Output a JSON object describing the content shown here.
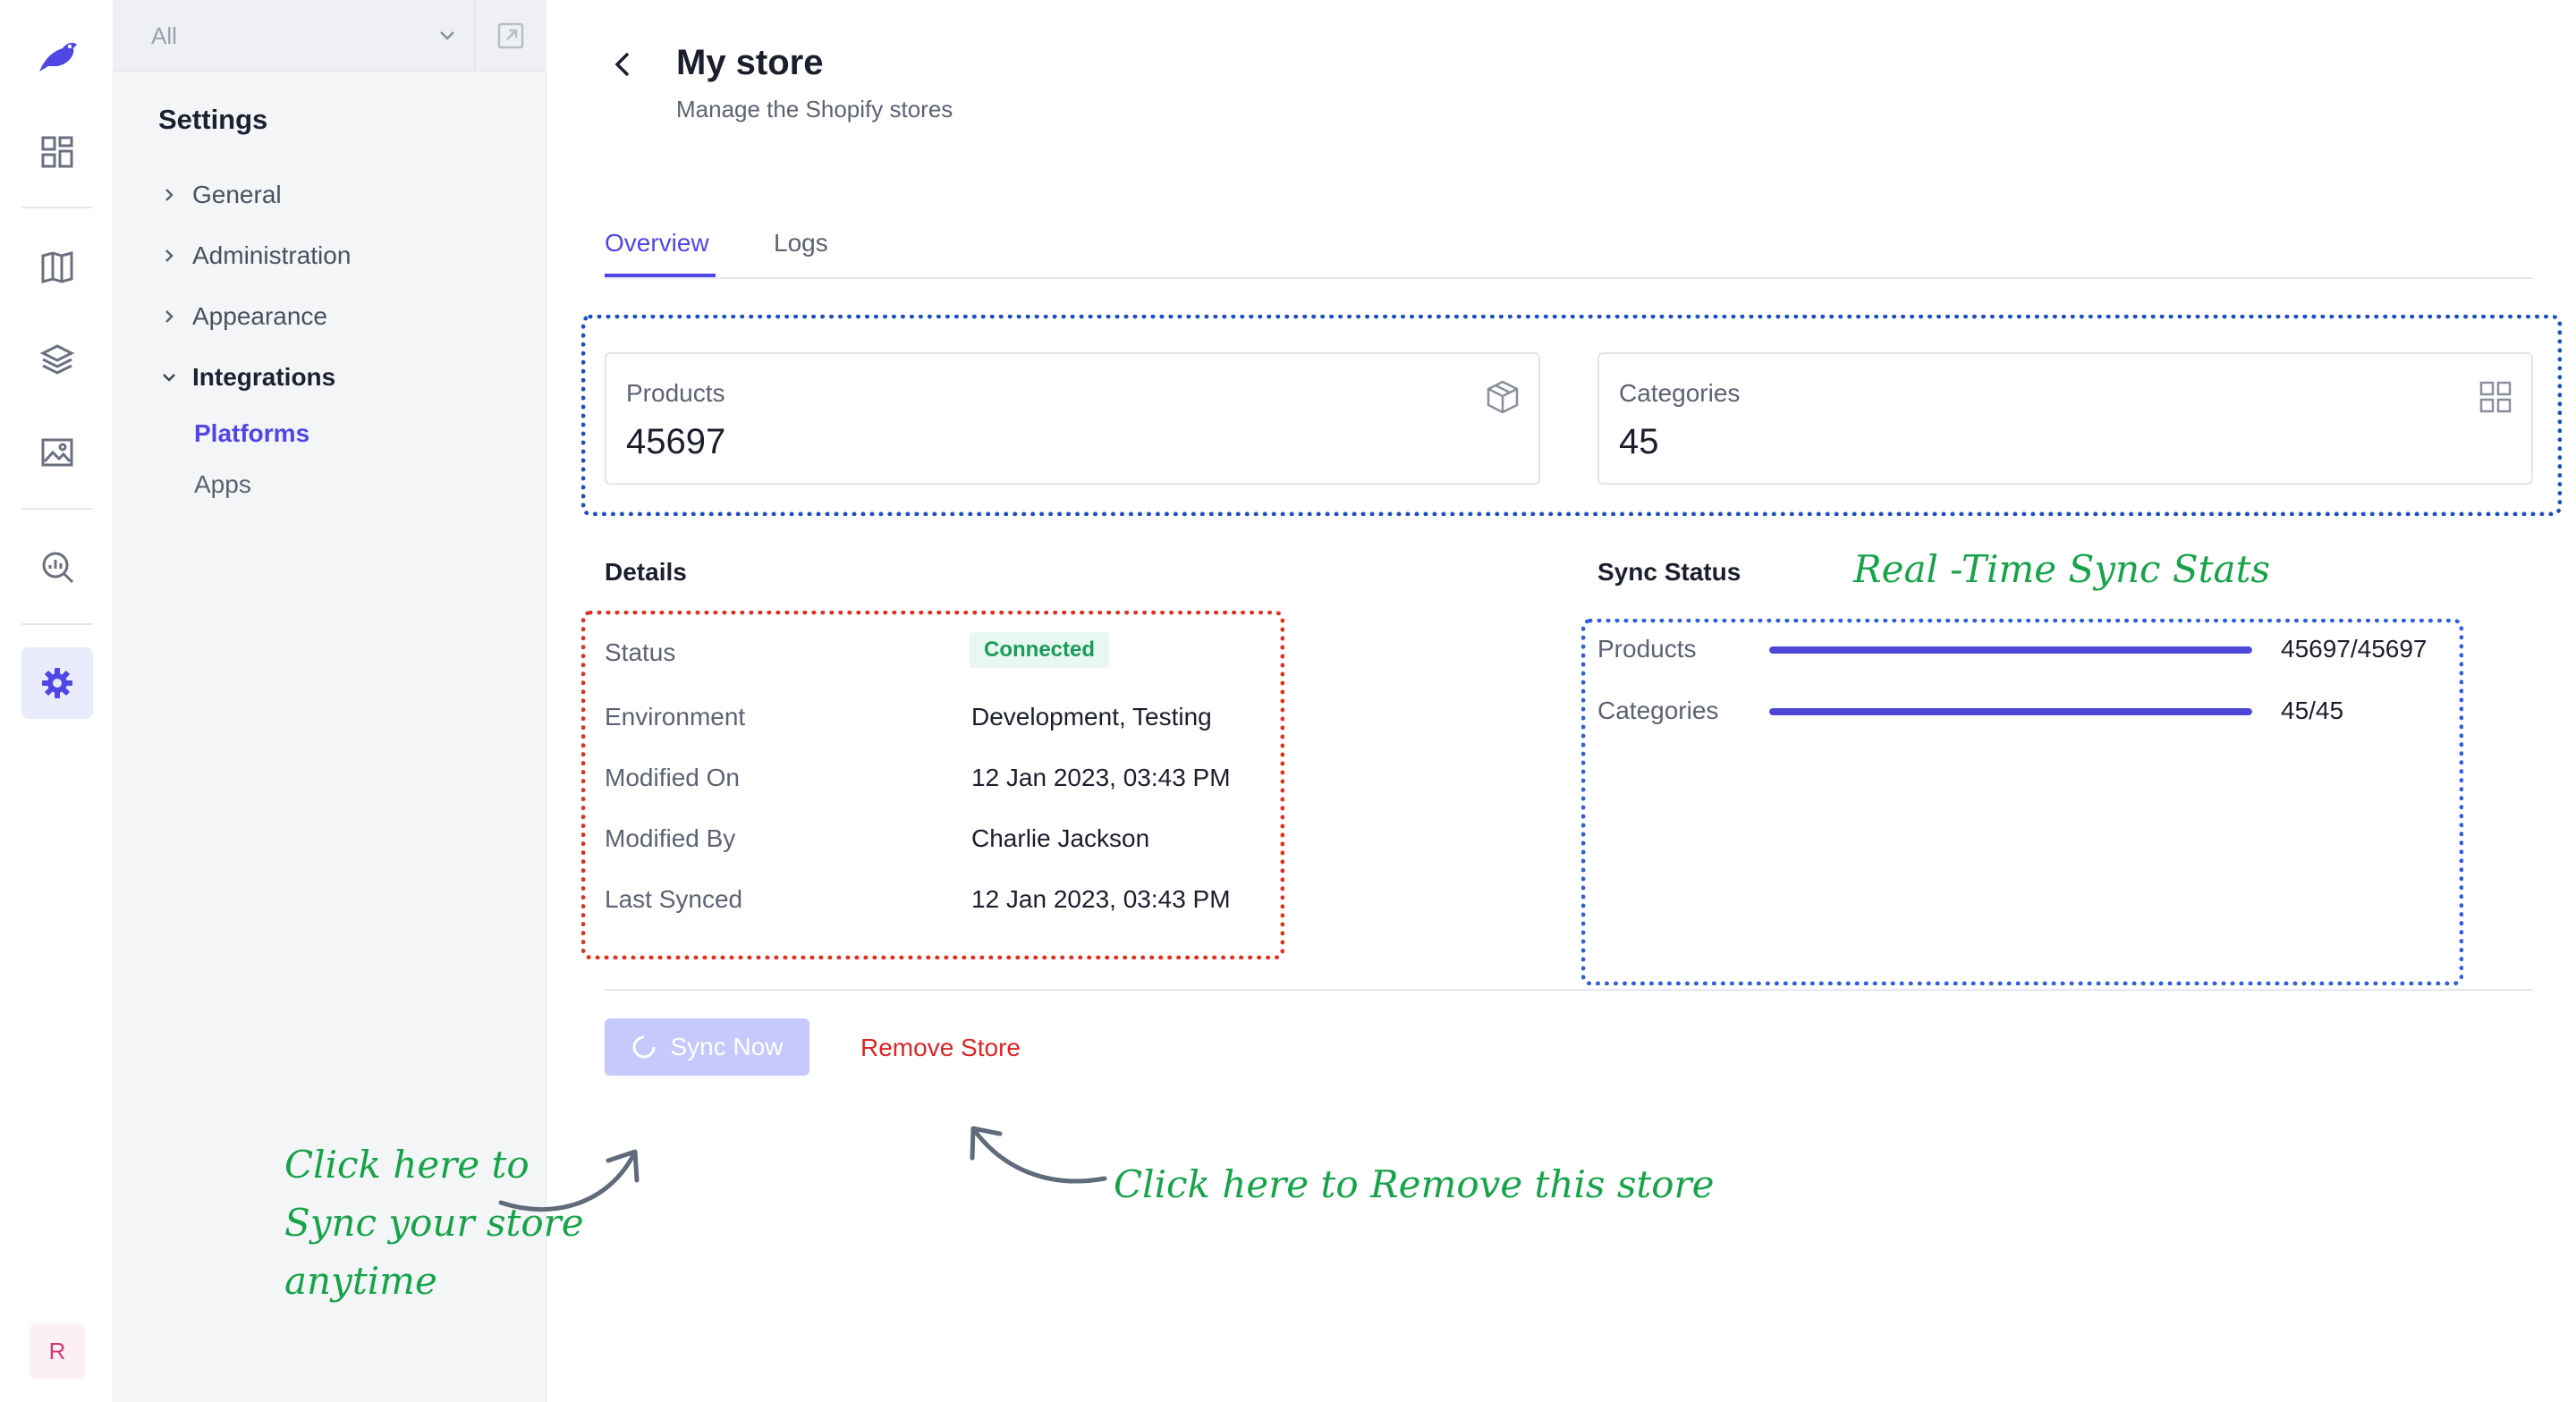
{
  "rail": {
    "icons": [
      "bird-logo-icon",
      "dashboard-icon",
      "catalog-icon",
      "layers-icon",
      "image-icon",
      "analytics-icon",
      "settings-icon"
    ],
    "avatar_initial": "R",
    "accent": "#4f46e5"
  },
  "sidebar": {
    "scope_value": "All",
    "title": "Settings",
    "items": [
      {
        "label": "General"
      },
      {
        "label": "Administration"
      },
      {
        "label": "Appearance"
      },
      {
        "label": "Integrations"
      }
    ],
    "integrations_children": [
      {
        "label": "Platforms",
        "active": true
      },
      {
        "label": "Apps",
        "active": false
      }
    ]
  },
  "header": {
    "title": "My store",
    "subtitle": "Manage the Shopify stores"
  },
  "tabs": [
    {
      "label": "Overview",
      "active": true
    },
    {
      "label": "Logs",
      "active": false
    }
  ],
  "stats": {
    "products": {
      "label": "Products",
      "value": "45697",
      "icon": "box-icon"
    },
    "categories": {
      "label": "Categories",
      "value": "45",
      "icon": "grid-icon"
    }
  },
  "details": {
    "heading": "Details",
    "status_label": "Status",
    "status_value": "Connected",
    "environment_label": "Environment",
    "environment_value": "Development, Testing",
    "modified_on_label": "Modified On",
    "modified_on_value": "12 Jan 2023, 03:43 PM",
    "modified_by_label": "Modified By",
    "modified_by_value": "Charlie Jackson",
    "last_synced_label": "Last Synced",
    "last_synced_value": "12 Jan 2023, 03:43 PM"
  },
  "sync_status": {
    "heading": "Sync Status",
    "rows": [
      {
        "label": "Products",
        "count": "45697/45697",
        "progress": 1.0
      },
      {
        "label": "Categories",
        "count": "45/45",
        "progress": 1.0
      }
    ]
  },
  "actions": {
    "sync_label": "Sync Now",
    "remove_label": "Remove Store"
  },
  "annotations": {
    "realtime": "Real -Time Sync Stats",
    "sync_line1": "Click here to",
    "sync_line2": "Sync your store",
    "sync_line3": "anytime",
    "remove": "Click here to Remove this store"
  }
}
